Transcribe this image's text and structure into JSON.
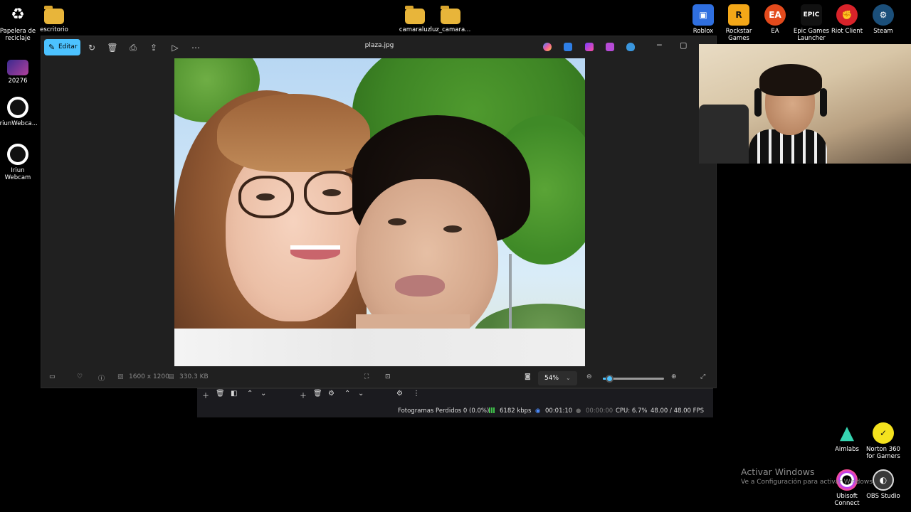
{
  "desktop": {
    "left_icons": [
      {
        "label": "Papelera de reciclaje",
        "icon": "recycle-bin-icon"
      },
      {
        "label": "escritorio",
        "icon": "folder-icon"
      },
      {
        "label": "20276",
        "icon": "image-file-icon"
      },
      {
        "label": "IriunWebca...",
        "icon": "iriun-webcam-icon"
      },
      {
        "label": "Iriun Webcam",
        "icon": "iriun-webcam-icon"
      }
    ],
    "top_folders": [
      {
        "label": "camaraluz",
        "icon": "folder-icon"
      },
      {
        "label": "luz_camara...",
        "icon": "folder-icon"
      }
    ],
    "right_icons": [
      {
        "label": "Roblox",
        "icon": "roblox-icon",
        "color": "#2f6fe0"
      },
      {
        "label": "Rockstar Games ...",
        "icon": "rockstar-icon",
        "color": "#f3a718"
      },
      {
        "label": "EA",
        "icon": "ea-icon",
        "color": "#e34a1c"
      },
      {
        "label": "Epic Games Launcher",
        "icon": "epic-games-icon",
        "color": "#111111"
      },
      {
        "label": "Riot Client",
        "icon": "riot-client-icon",
        "color": "#d8232a"
      },
      {
        "label": "Steam",
        "icon": "steam-icon",
        "color": "#1b4f7a"
      }
    ],
    "bottom_right_icons": [
      {
        "label": "Aimlabs",
        "icon": "aimlabs-icon",
        "color": "#35d3b0"
      },
      {
        "label": "Norton 360 for Gamers",
        "icon": "norton-icon",
        "color": "#f4e21e"
      },
      {
        "label": "Ubisoft Connect",
        "icon": "ubisoft-icon",
        "color": "#ffffff"
      },
      {
        "label": "OBS Studio",
        "icon": "obs-icon",
        "color": "#3a3a3a"
      }
    ]
  },
  "viewer": {
    "edit_label": "Editar",
    "file_name": "plaza.jpg",
    "toolbar_icons": [
      "rotate-icon",
      "delete-icon",
      "print-icon",
      "share-icon",
      "slideshow-icon",
      "more-icon"
    ],
    "app_icons": [
      "copilot-icon",
      "designer-icon",
      "clipchamp-icon",
      "photos-app-icon",
      "onedrive-icon"
    ],
    "dimensions": "1600 x 1200",
    "file_size": "330.3 KB",
    "zoom": "54%",
    "zoom_fraction": 0.1
  },
  "obs": {
    "dropped_frames": "Fotogramas Perdidos 0 (0.0%)",
    "bitrate": "6182 kbps",
    "stream_time": "00:01:10",
    "record_time": "00:00:00",
    "cpu": "CPU: 6.7%",
    "fps": "48.00 / 48.00 FPS"
  },
  "watermark": {
    "title": "Activar Windows",
    "subtitle": "Ve a Configuración para activar Windows."
  }
}
